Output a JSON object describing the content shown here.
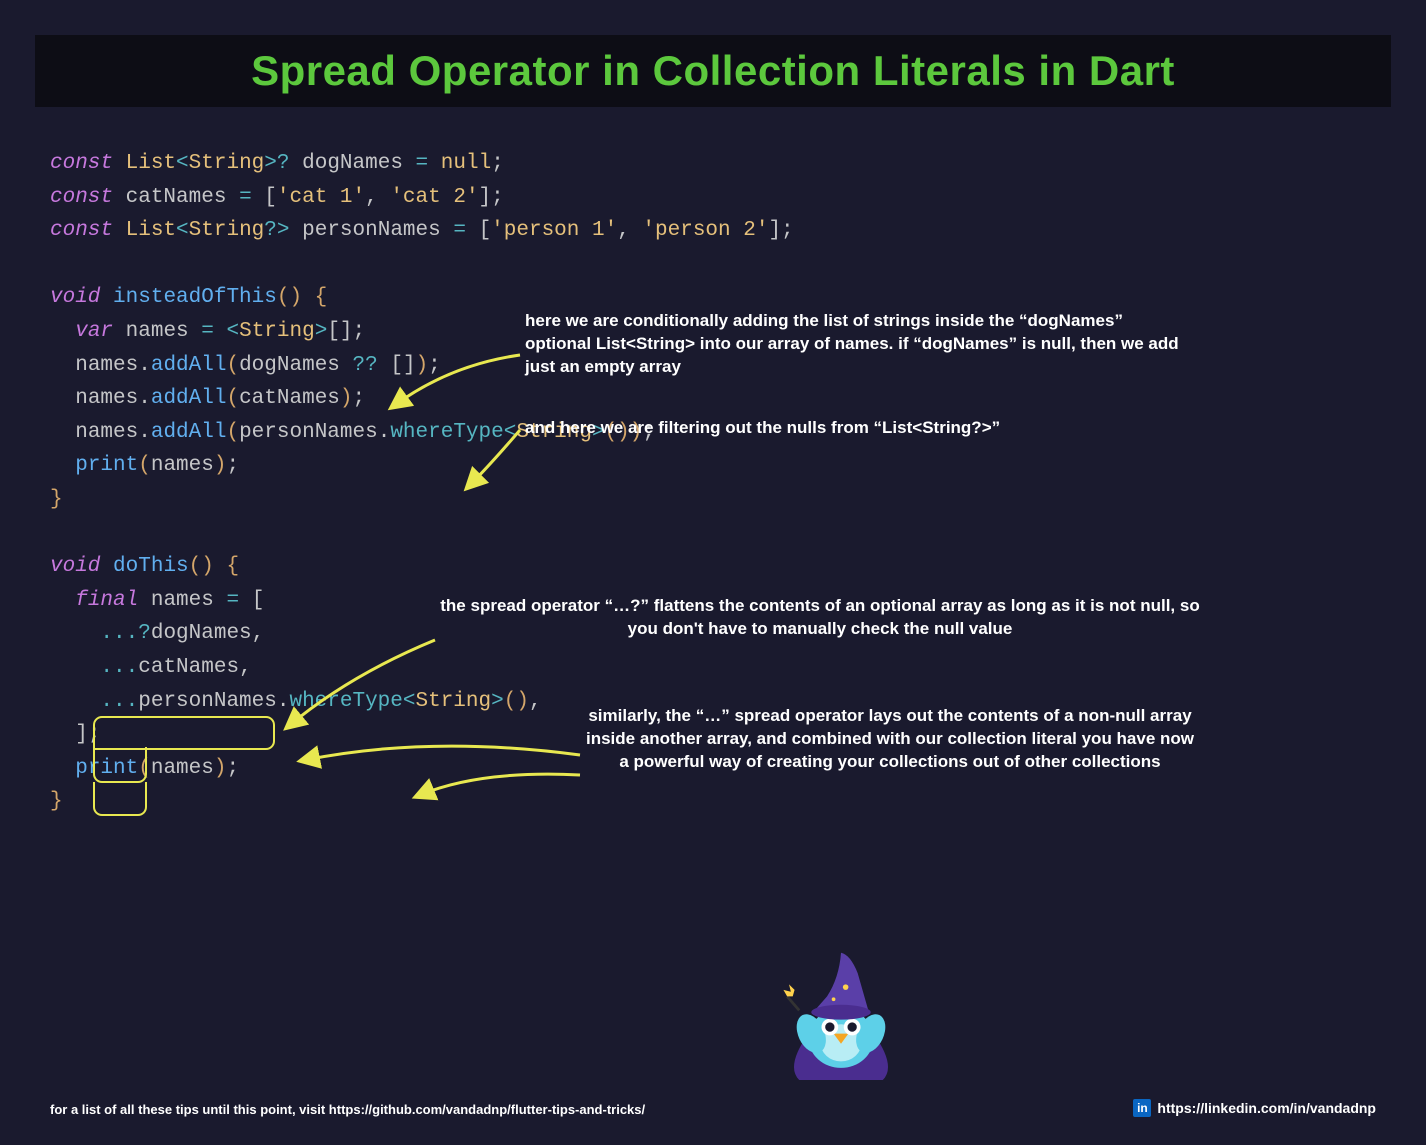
{
  "title": "Spread Operator in Collection Literals in Dart",
  "code": {
    "l1_const": "const",
    "l1_type": "List",
    "l1_string": "String",
    "l1_q": "?",
    "l1_ident": "dogNames",
    "l1_eq": "=",
    "l1_null": "null",
    "l2_const": "const",
    "l2_ident": "catNames",
    "l2_eq": "=",
    "l2_s1": "'cat 1'",
    "l2_s2": "'cat 2'",
    "l3_const": "const",
    "l3_type": "List",
    "l3_string": "String",
    "l3_q": "?",
    "l3_ident": "personNames",
    "l3_eq": "=",
    "l3_s1": "'person 1'",
    "l3_s2": "'person 2'",
    "f1_void": "void",
    "f1_name": "insteadOfThis",
    "f1_var": "var",
    "f1_names": "names",
    "f1_string": "String",
    "f1_addAll": "addAll",
    "f1_dogNames": "dogNames",
    "f1_qq": "??",
    "f1_catNames": "catNames",
    "f1_personNames": "personNames",
    "f1_whereType": "whereType",
    "f1_print": "print",
    "f2_void": "void",
    "f2_name": "doThis",
    "f2_final": "final",
    "f2_names": "names",
    "f2_spreadq": "...?",
    "f2_spread": "...",
    "f2_dogNames": "dogNames",
    "f2_catNames": "catNames",
    "f2_personNames": "personNames",
    "f2_whereType": "whereType",
    "f2_string": "String",
    "f2_print": "print"
  },
  "annotations": {
    "a1": "here we are conditionally adding the list of strings inside the “dogNames” optional List<String> into our array of names. if “dogNames” is null, then we add just an empty array",
    "a2": "and here we are filtering out the nulls from “List<String?>”",
    "a3": "the spread operator “…?” flattens the contents of an optional array as long as it is not null, so you don't have to manually check the null value",
    "a4": "similarly, the “…” spread operator lays out the contents of a non-null array inside another array, and combined with our collection literal you have now a powerful way of creating your collections out of other collections"
  },
  "footer": {
    "left": "for a list of all these tips until this point, visit https://github.com/vandadnp/flutter-tips-and-tricks/",
    "right": "https://linkedin.com/in/vandadnp",
    "linkedin_label": "in"
  }
}
